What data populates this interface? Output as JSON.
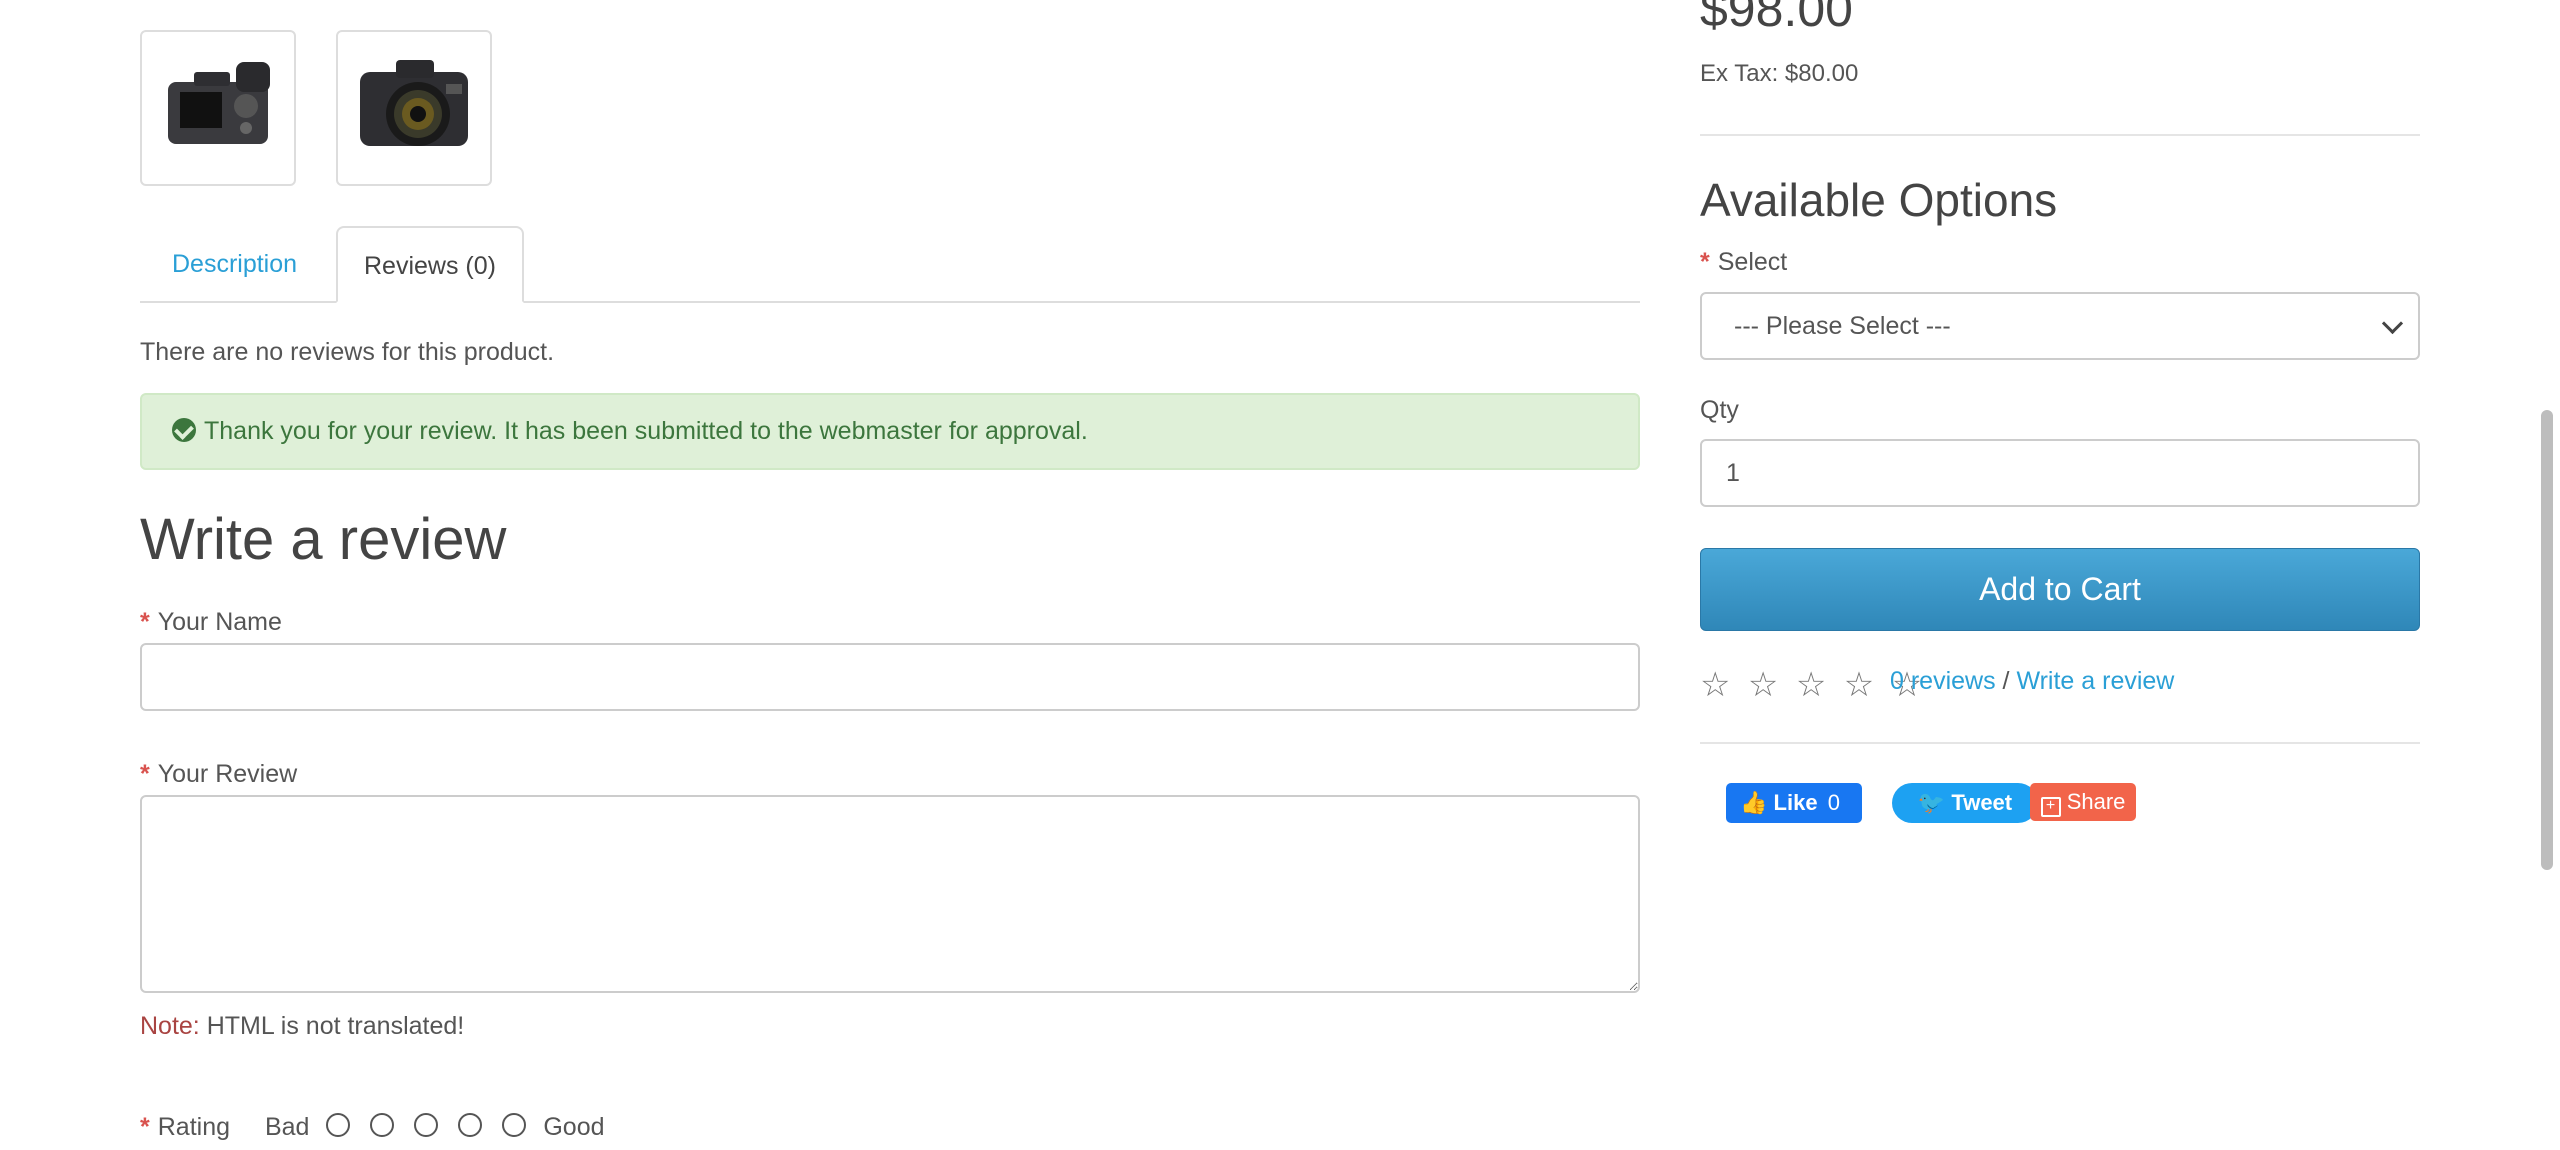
{
  "product": {
    "price": "$98.00",
    "ex_tax": "Ex Tax: $80.00",
    "thumbnails": [
      "camera-back-thumbnail",
      "camera-front-thumbnail"
    ]
  },
  "tabs": [
    {
      "label": "Description",
      "active": false
    },
    {
      "label": "Reviews (0)",
      "active": true
    }
  ],
  "reviews": {
    "empty_text": "There are no reviews for this product.",
    "success_alert": "Thank you for your review. It has been submitted to the webmaster for approval.",
    "form": {
      "title": "Write a review",
      "name_label": "Your Name",
      "name_value": "",
      "review_label": "Your Review",
      "review_value": "",
      "note_label": "Note:",
      "note_text": "HTML is not translated!",
      "rating_label": "Rating",
      "rating_bad": "Bad",
      "rating_good": "Good",
      "rating_options": 5
    }
  },
  "options": {
    "title": "Available Options",
    "select_label": "Select",
    "select_value": "--- Please Select ---",
    "qty_label": "Qty",
    "qty_value": "1",
    "add_to_cart": "Add to Cart"
  },
  "rating_summary": {
    "stars": "☆ ☆ ☆ ☆ ☆",
    "reviews_link": "0 reviews",
    "separator": "/",
    "write_link": "Write a review"
  },
  "social": {
    "like_label": "Like",
    "like_count": "0",
    "tweet_label": "Tweet",
    "share_label": "Share"
  },
  "colors": {
    "link": "#2a9fd6",
    "success_bg": "#dff0d8",
    "success_text": "#3c763d",
    "required": "#d9534f",
    "cart_button": "#3a95c8",
    "facebook": "#1877f2",
    "twitter": "#1da1f2",
    "share": "#f2644a"
  }
}
